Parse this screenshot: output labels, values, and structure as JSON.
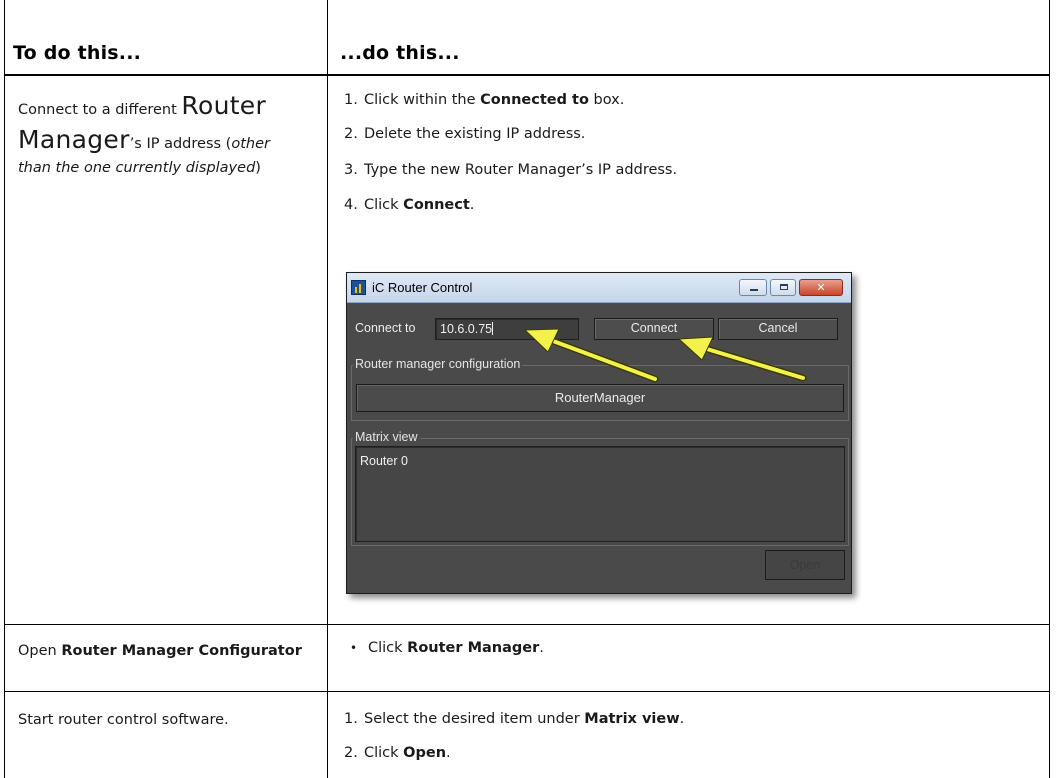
{
  "table": {
    "header": {
      "col1": "To do this...",
      "col2": "...do this..."
    },
    "rows": [
      {
        "task_prefix": "Connect to a different ",
        "task_big1": "Router",
        "task_big2": "Manager",
        "task_suffix": "’s IP address (",
        "task_italic": "other than the one currently displayed",
        "task_close": ")",
        "steps": [
          {
            "num": "1.",
            "pre": "Click within the ",
            "bold": "Connected to",
            "post": " box."
          },
          {
            "num": "2.",
            "pre": "Delete the existing IP address.",
            "bold": "",
            "post": ""
          },
          {
            "num": "3.",
            "pre": "Type the new Router Manager’s IP address.",
            "bold": "",
            "post": ""
          },
          {
            "num": "4.",
            "pre": "Click ",
            "bold": "Connect",
            "post": "."
          }
        ]
      },
      {
        "task_prefix": "Open ",
        "task_bold": "Router Manager Configurator",
        "bullet": "•",
        "step_pre": "Click ",
        "step_bold": "Router Manager",
        "step_post": "."
      },
      {
        "task": "Start router control software.",
        "steps": [
          {
            "num": "1.",
            "pre": "Select the desired item under ",
            "bold": "Matrix view",
            "post": "."
          },
          {
            "num": "2.",
            "pre": "Click ",
            "bold": "Open",
            "post": "."
          }
        ]
      }
    ]
  },
  "dialog": {
    "title": "iC Router Control",
    "connect_label": "Connect to",
    "ip_value": "10.6.0.75",
    "connect_button": "Connect",
    "cancel_button": "Cancel",
    "router_group_title": "Router manager configuration",
    "router_manager_button": "RouterManager",
    "matrix_group_title": "Matrix view",
    "matrix_items": [
      "Router 0"
    ],
    "open_button": "Open",
    "window_buttons": {
      "minimize": "minimize-icon",
      "maximize": "maximize-icon",
      "close": "close-icon"
    }
  },
  "colors": {
    "dialog_bg": "#4a4a4a",
    "titlebar": "#c5d6ea",
    "arrow": "#f2f24a",
    "close_button": "#c8452a"
  }
}
